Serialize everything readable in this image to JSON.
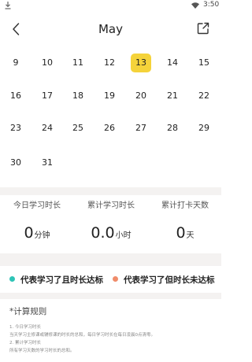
{
  "status_bar": {
    "time": "3:50",
    "icons": [
      "download-icon",
      "wifi-icon"
    ]
  },
  "header": {
    "title": "May",
    "back_icon": "chevron-left-icon",
    "share_icon": "share-icon"
  },
  "calendar": {
    "weeks": [
      [
        "9",
        "10",
        "11",
        "12",
        "13",
        "14",
        "15"
      ],
      [
        "16",
        "17",
        "18",
        "19",
        "20",
        "21",
        "22"
      ],
      [
        "23",
        "24",
        "25",
        "26",
        "27",
        "28",
        "29"
      ],
      [
        "30",
        "31"
      ]
    ],
    "selected_day": "13",
    "selected_color": "#f5d33a"
  },
  "stats": {
    "today": {
      "label": "今日学习时长",
      "value": "0",
      "unit": "分钟"
    },
    "total": {
      "label": "累计学习时长",
      "value": "0.0",
      "unit": "小时"
    },
    "days": {
      "label": "累计打卡天数",
      "value": "0",
      "unit": "天"
    }
  },
  "legend": {
    "reached": {
      "text": "代表学习了且时长达标",
      "color": "#2ec4b6"
    },
    "not_reached": {
      "text": "代表学习了但时长未达标",
      "color": "#f08c6a"
    }
  },
  "rules": {
    "title": "*计算规则",
    "lines": [
      "1. 今日学习时长",
      "当天学习主修课或辅修课的时长的总和，每日学习时长在每日凌晨0点清零。",
      "2. 累计学习时长",
      "所有学习天数的学习时长的总和。"
    ]
  }
}
